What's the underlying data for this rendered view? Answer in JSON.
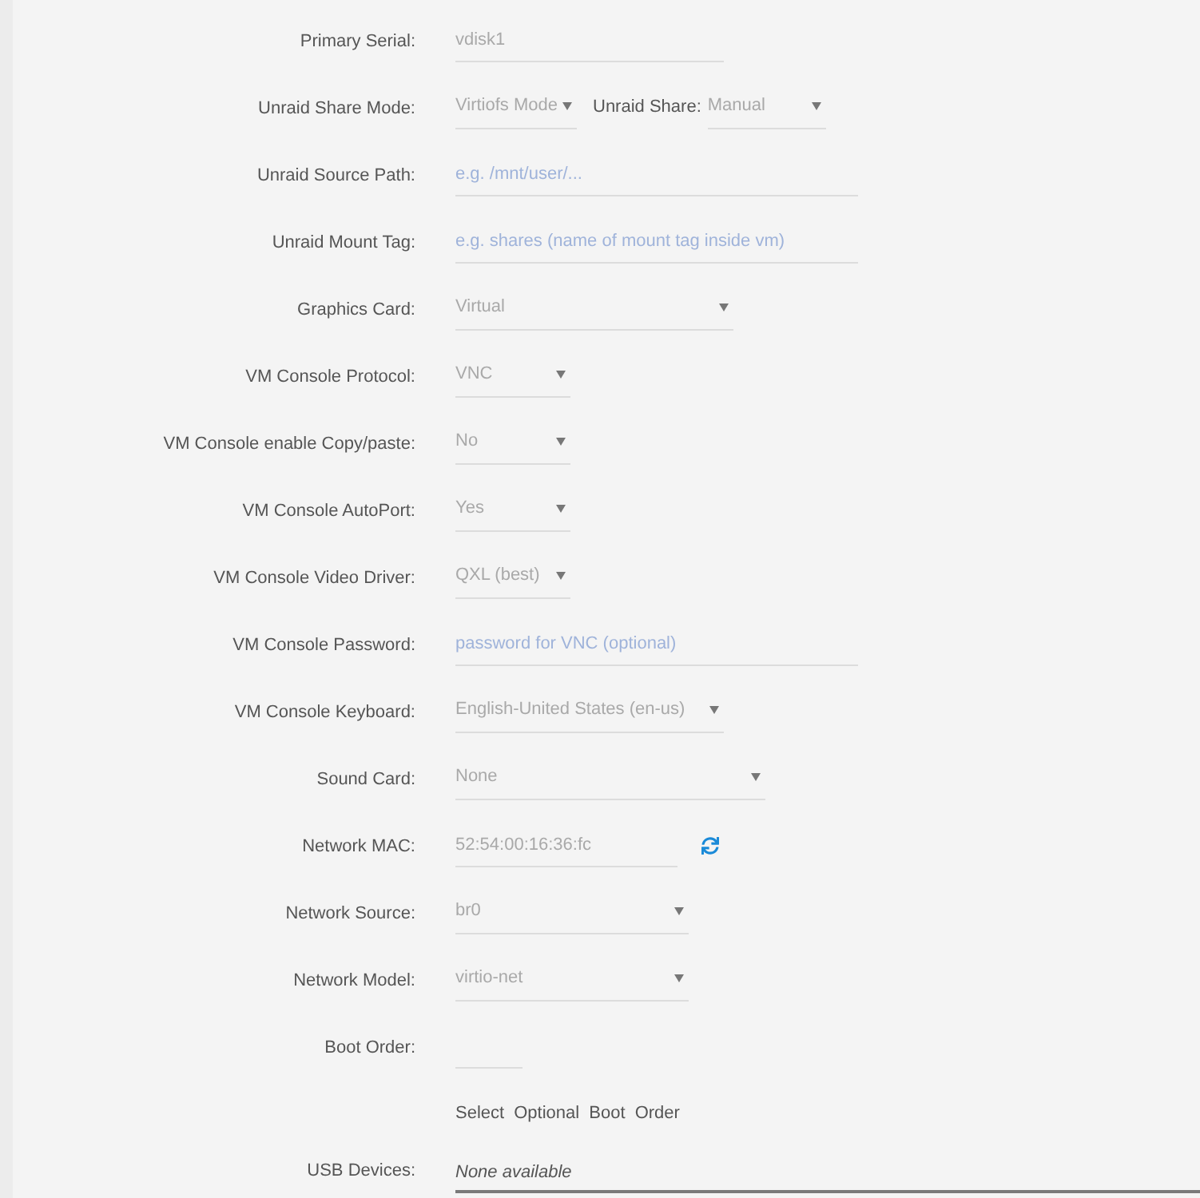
{
  "form": {
    "rows": [
      {
        "label": "Primary Serial:",
        "controls": [
          {
            "kind": "input",
            "value": "vdisk1"
          }
        ]
      },
      {
        "label": "Unraid Share Mode:",
        "controls": [
          {
            "kind": "select",
            "value": "Virtiofs Mode"
          },
          {
            "kind": "label",
            "text": "Unraid Share:"
          },
          {
            "kind": "select",
            "value": "Manual"
          }
        ]
      },
      {
        "label": "Unraid Source Path:",
        "controls": [
          {
            "kind": "input",
            "placeholder": "e.g. /mnt/user/..."
          }
        ]
      },
      {
        "label": "Unraid Mount Tag:",
        "controls": [
          {
            "kind": "input",
            "placeholder": "e.g. shares (name of mount tag inside vm)"
          }
        ]
      },
      {
        "label": "Graphics Card:",
        "controls": [
          {
            "kind": "select",
            "value": "Virtual"
          }
        ]
      },
      {
        "label": "VM Console Protocol:",
        "controls": [
          {
            "kind": "select",
            "value": "VNC"
          }
        ]
      },
      {
        "label": "VM Console enable Copy/paste:",
        "controls": [
          {
            "kind": "select",
            "value": "No"
          }
        ]
      },
      {
        "label": "VM Console AutoPort:",
        "controls": [
          {
            "kind": "select",
            "value": "Yes"
          }
        ]
      },
      {
        "label": "VM Console Video Driver:",
        "controls": [
          {
            "kind": "select",
            "value": "QXL (best)"
          }
        ]
      },
      {
        "label": "VM Console Password:",
        "controls": [
          {
            "kind": "input",
            "placeholder": "password for VNC (optional)"
          }
        ]
      },
      {
        "label": "VM Console Keyboard:",
        "controls": [
          {
            "kind": "select",
            "value": "English-United States (en-us)"
          }
        ]
      },
      {
        "label": "Sound Card:",
        "controls": [
          {
            "kind": "select",
            "value": "None"
          }
        ]
      },
      {
        "label": "Network MAC:",
        "controls": [
          {
            "kind": "input",
            "value": "52:54:00:16:36:fc"
          },
          {
            "kind": "refresh"
          }
        ]
      },
      {
        "label": "Network Source:",
        "controls": [
          {
            "kind": "select",
            "value": "br0"
          }
        ]
      },
      {
        "label": "Network Model:",
        "controls": [
          {
            "kind": "select",
            "value": "virtio-net"
          }
        ]
      },
      {
        "label": "Boot Order:",
        "controls": [
          {
            "kind": "input"
          }
        ]
      },
      {
        "controls": [
          {
            "kind": "note",
            "text": "Select Optional Boot Order"
          }
        ]
      },
      {
        "label": "USB Devices:",
        "controls": [
          {
            "kind": "static",
            "text": "None available"
          }
        ]
      }
    ]
  }
}
